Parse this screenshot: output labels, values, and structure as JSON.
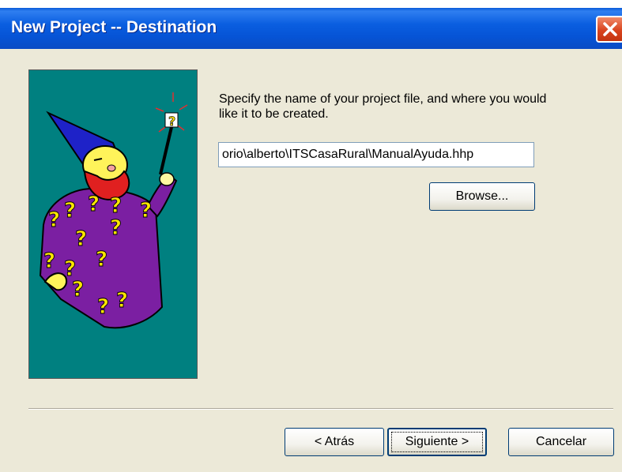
{
  "window": {
    "title": "New Project -- Destination"
  },
  "main": {
    "instruction": "Specify the name of your project file, and where you would like it to be created.",
    "path_value": "orio\\alberto\\ITSCasaRural\\ManualAyuda.hhp",
    "browse_label": "Browse..."
  },
  "footer": {
    "back_label": "< Atrás",
    "next_label": "Siguiente >",
    "cancel_label": "Cancelar"
  },
  "icons": {
    "wizard": "wizard-illustration-icon",
    "close": "close-icon"
  },
  "colors": {
    "titlebar": "#0a5ee0",
    "dialog_bg": "#ece9d8",
    "wizard_bg": "#008080",
    "robe": "#7b1fa2",
    "hat": "#1e22c8",
    "beard": "#e02020"
  }
}
